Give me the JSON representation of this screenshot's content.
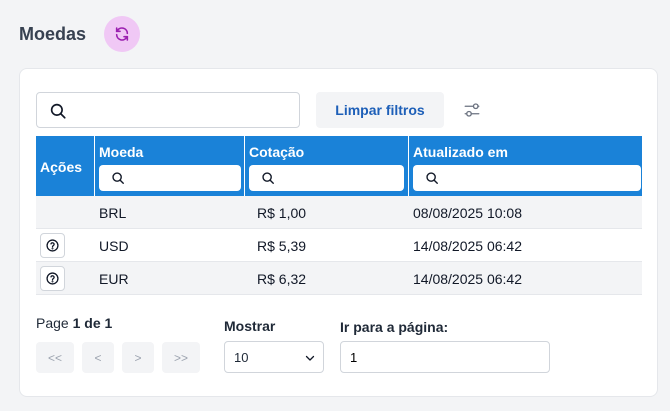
{
  "header": {
    "title": "Moedas",
    "refresh_icon": "refresh-icon",
    "accent": "#f0c8f5"
  },
  "toolbar": {
    "search_value": "",
    "clear_label": "Limpar filtros",
    "settings_icon": "sliders-icon"
  },
  "table": {
    "header_color": "#1a82d8",
    "columns": [
      {
        "label": "Ações"
      },
      {
        "label": "Moeda",
        "filter_value": ""
      },
      {
        "label": "Cotação",
        "filter_value": ""
      },
      {
        "label": "Atualizado em",
        "filter_value": ""
      }
    ],
    "rows": [
      {
        "moeda": "BRL",
        "cotacao": "R$ 1,00",
        "atualizado": "08/08/2025 10:08",
        "has_action": false
      },
      {
        "moeda": "USD",
        "cotacao": "R$ 5,39",
        "atualizado": "14/08/2025 06:42",
        "has_action": true
      },
      {
        "moeda": "EUR",
        "cotacao": "R$ 6,32",
        "atualizado": "14/08/2025 06:42",
        "has_action": true
      }
    ]
  },
  "pagination": {
    "page_prefix": "Page",
    "page_current": "1 de 1",
    "first": "<<",
    "prev": "<",
    "next": ">",
    "last": ">>",
    "show_label": "Mostrar",
    "show_value": "10",
    "goto_label": "Ir para a página:",
    "goto_value": "1"
  }
}
